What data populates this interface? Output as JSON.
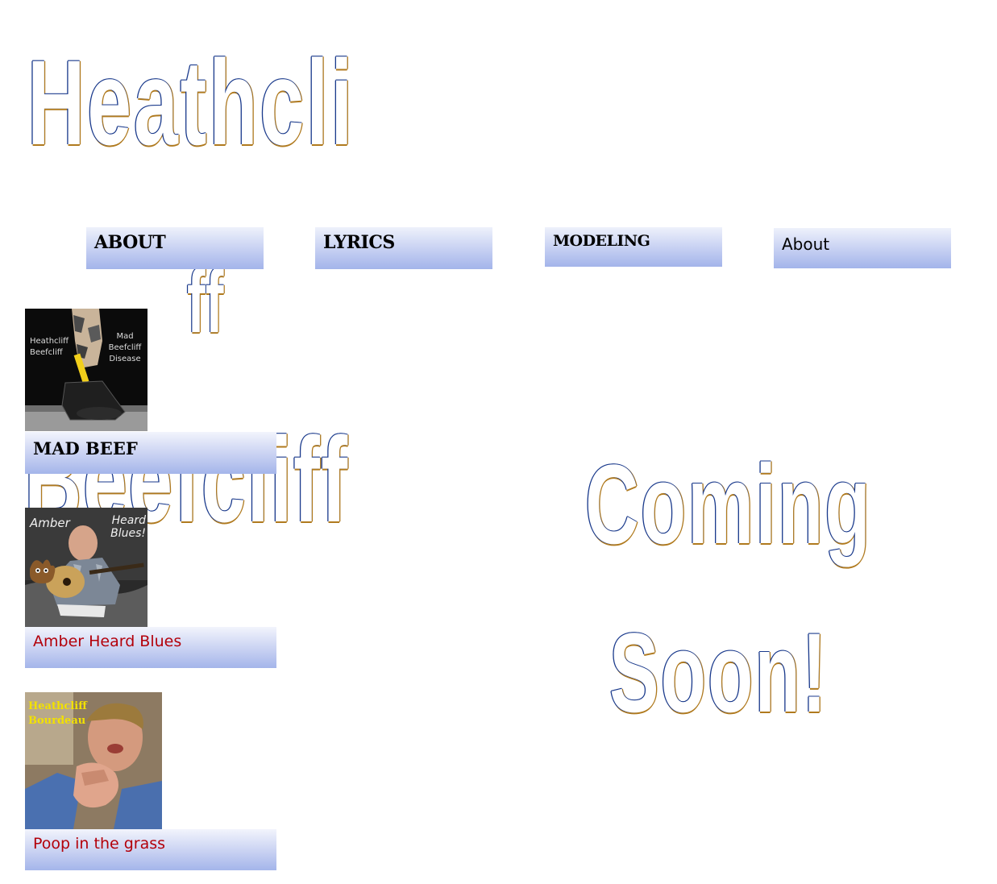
{
  "header": {
    "title_line1": "Heathcli",
    "title_line2": "ff",
    "title_line3": "Beefcliff"
  },
  "nav": {
    "about": "ABOUT",
    "lyrics": "LYRICS",
    "modeling": "MODELING",
    "about_alt": "About"
  },
  "main": {
    "coming": "Coming",
    "soon": "Soon!"
  },
  "songs": [
    {
      "title": "MAD BEEF",
      "cover_text_left": "Heathcliff Beefcliff",
      "cover_text_right": "Mad Beefcliff Disease"
    },
    {
      "title": "Amber Heard Blues",
      "cover_text_left": "Amber",
      "cover_text_right": "Heard Blues!"
    },
    {
      "title": "Poop in the grass",
      "cover_text": "Heathcliff Bourdeau"
    }
  ],
  "colors": {
    "outline_blue": "#1a3a8c",
    "outline_gold": "#b07a1e",
    "link_red": "#b3000a",
    "button_gradient_bottom": "#a3b4ea"
  }
}
